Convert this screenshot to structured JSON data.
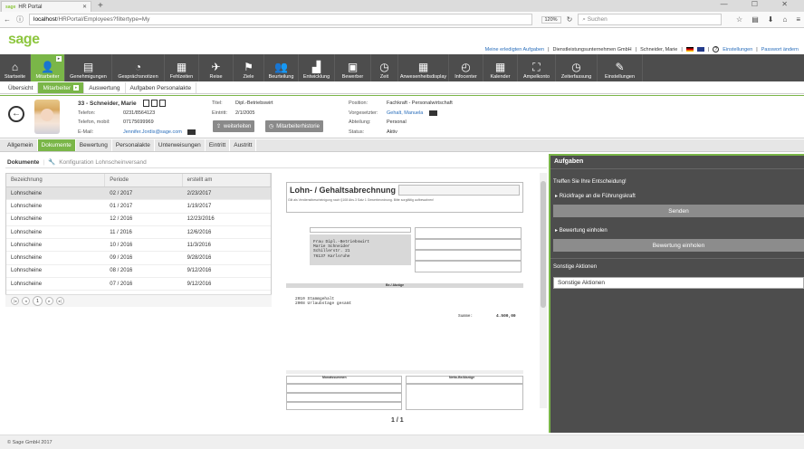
{
  "browser": {
    "tab_title": "HR Portal",
    "tab_favicon": "sage",
    "new_tab": "+",
    "url_host": "localhost",
    "url_path": "/HRPortal/Employees?filtertype=My",
    "zoom": "120%",
    "search_placeholder": "Suchen",
    "window_controls": "— ☐ ✕"
  },
  "app": {
    "logo": "sage",
    "top_links": [
      "Meine erledigten Aufgaben",
      "Dienstleistungsunternehmen GmbH",
      "Schneider, Marie",
      "Einstellungen",
      "Passwort ändern"
    ]
  },
  "main_nav": [
    {
      "label": "Startseite",
      "icon": "home-icon",
      "glyph": "⌂"
    },
    {
      "label": "Mitarbeiter",
      "icon": "employees-icon",
      "glyph": "👤",
      "active": true
    },
    {
      "label": "Genehmigungen",
      "icon": "approvals-icon",
      "glyph": "▤"
    },
    {
      "label": "Gesprächsnotizen",
      "icon": "conversation-icon",
      "glyph": "◔"
    },
    {
      "label": "Fehlzeiten",
      "icon": "absence-calendar-icon",
      "glyph": "▦"
    },
    {
      "label": "Reise",
      "icon": "airplane-icon",
      "glyph": "✈"
    },
    {
      "label": "Ziele",
      "icon": "flag-icon",
      "glyph": "⚑"
    },
    {
      "label": "Beurteilung",
      "icon": "rating-icon",
      "glyph": "👥"
    },
    {
      "label": "Entwicklung",
      "icon": "development-chart-icon",
      "glyph": "▟"
    },
    {
      "label": "Bewerber",
      "icon": "applicant-icon",
      "glyph": "▣"
    },
    {
      "label": "Zeit",
      "icon": "time-icon",
      "glyph": "◷"
    },
    {
      "label": "Anwesenheitsdisplay",
      "icon": "grid-icon",
      "glyph": "▦"
    },
    {
      "label": "Infocenter",
      "icon": "infocenter-icon",
      "glyph": "◴"
    },
    {
      "label": "Kalender",
      "icon": "calendar-icon",
      "glyph": "▦"
    },
    {
      "label": "Ampelkonto",
      "icon": "traffic-light-icon",
      "glyph": "⛶"
    },
    {
      "label": "Zeiterfassung",
      "icon": "time-tracking-icon",
      "glyph": "◷"
    },
    {
      "label": "Einstellungen",
      "icon": "wrench-icon",
      "glyph": "✎"
    }
  ],
  "sub_nav": [
    {
      "label": "Übersicht"
    },
    {
      "label": "Mitarbeiter",
      "active": true
    },
    {
      "label": "Auswertung"
    },
    {
      "label": "Aufgaben Personalakte"
    }
  ],
  "profile": {
    "name": "33 - Schneider, Marie",
    "phone_label": "Telefon:",
    "phone": "0231/8564123",
    "mobile_label": "Telefon, mobil:",
    "mobile": "07175699969",
    "email_label": "E-Mail:",
    "email": "Jennifer.Jordis@sage.com",
    "title_label": "Titel:",
    "title": "Dipl.-Betriebswirt",
    "entry_label": "Eintritt:",
    "entry": "2/1/2005",
    "forward_btn": "weiterleiten",
    "history_btn": "Mitarbeiterhistorie",
    "position_label": "Position:",
    "position": "Fachkraft - Personalwirtschaft",
    "supervisor_label": "Vorgesetzter:",
    "supervisor": "Gehalt, Manuela",
    "department_label": "Abteilung:",
    "department": "Personal",
    "status_label": "Status:",
    "status": "Aktiv"
  },
  "detail_tabs": [
    "Allgemein",
    "Dokumente",
    "Bewertung",
    "Personalakte",
    "Unterweisungen",
    "Eintritt",
    "Austritt"
  ],
  "active_detail_tab": "Dokumente",
  "breadcrumb": {
    "current": "Dokumente",
    "link": "Konfiguration Lohnscheinversand"
  },
  "documents_table": {
    "columns": [
      "Bezeichnung",
      "Periode",
      "erstellt am"
    ],
    "rows": [
      [
        "Lohnscheine",
        "02 / 2017",
        "2/23/2017"
      ],
      [
        "Lohnscheine",
        "01 / 2017",
        "1/19/2017"
      ],
      [
        "Lohnscheine",
        "12 / 2016",
        "12/23/2016"
      ],
      [
        "Lohnscheine",
        "11 / 2016",
        "12/6/2016"
      ],
      [
        "Lohnscheine",
        "10 / 2016",
        "11/3/2016"
      ],
      [
        "Lohnscheine",
        "09 / 2016",
        "9/28/2016"
      ],
      [
        "Lohnscheine",
        "08 / 2016",
        "9/12/2016"
      ],
      [
        "Lohnscheine",
        "07 / 2016",
        "9/12/2016"
      ]
    ],
    "selected_row": 0,
    "pager_current": "1"
  },
  "viewer": {
    "doc_title": "Lohn- / Gehaltsabrechnung",
    "address_lines": [
      "Frau Dipl.-Betriebswirt",
      "Marie Schneider",
      "Schillerstr. 21",
      "76137 Karlsruhe"
    ],
    "section_bezuege": "Be-/ Abzüge",
    "section_monatssummen": "Monatssummen",
    "section_netto": "Netto-Be/Abzüge",
    "entries": [
      "2010 Stammgehalt",
      "2008 Urlaubstage gesamt"
    ],
    "summe_label": "Summe:",
    "summe_value": "4.500,00",
    "page_info": "1 / 1"
  },
  "tasks": {
    "title": "Aufgaben",
    "prompt": "Treffen Sie Ihre Entscheidung!",
    "option1": "Rückfrage an die Führungskraft",
    "send_btn": "Senden",
    "option2": "Bewertung einholen",
    "fetch_btn": "Bewertung einholen",
    "other_label": "Sonstige Aktionen",
    "other_select": "Sonstige Aktionen"
  },
  "footer": "© Sage GmbH 2017",
  "colors": {
    "accent": "#7ab648",
    "nav_bg": "#4d4d4d",
    "link": "#2a6ebb"
  }
}
